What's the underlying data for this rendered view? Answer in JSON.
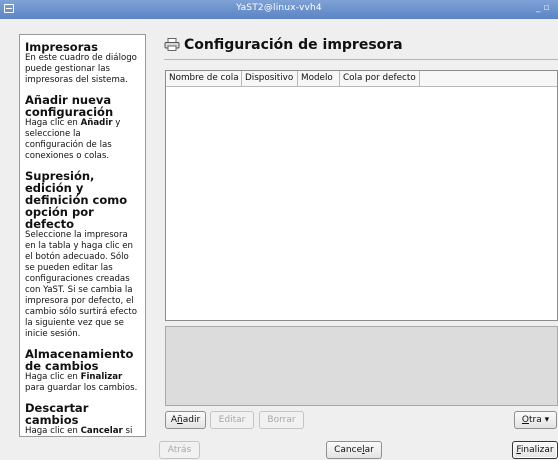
{
  "window": {
    "title": "YaST2@linux-vvh4",
    "controls": "_ ▫"
  },
  "help": {
    "sections": [
      {
        "heading": "Impresoras",
        "text": "En este cuadro de diálogo puede gestionar las impresoras del sistema."
      },
      {
        "heading": "Añadir nueva configuración",
        "text_pre": "Haga clic en ",
        "bold": "Añadir",
        "text_post": " y seleccione la configuración de las conexiones o colas."
      },
      {
        "heading": "Supresión, edición y definición como opción por defecto",
        "text": "Seleccione la impresora en la tabla y haga clic en el botón adecuado. Sólo se pueden editar las configuraciones creadas con YaST. Si se cambia la impresora por defecto, el cambio sólo surtirá efecto la siguiente vez que se inicie sesión."
      },
      {
        "heading": "Almacenamiento de cambios",
        "text_pre": "Haga clic en ",
        "bold": "Finalizar",
        "text_post": " para guardar los cambios."
      },
      {
        "heading": "Descartar cambios",
        "text_pre": "Haga clic en ",
        "bold": "Cancelar",
        "text_post": " si no desea guardar los cambios."
      }
    ]
  },
  "main": {
    "title": "Configuración de impresora",
    "table": {
      "columns": [
        "Nombre de cola",
        "Dispositivo",
        "Modelo",
        "Cola por defecto"
      ],
      "rows": []
    }
  },
  "actions": {
    "add": "Añadir",
    "add_u": "d",
    "edit": "Editar",
    "delete": "Borrar",
    "other": "Otra ▾"
  },
  "nav": {
    "back": "Atrás",
    "cancel": "Cancelar",
    "finish": "Finalizar"
  }
}
